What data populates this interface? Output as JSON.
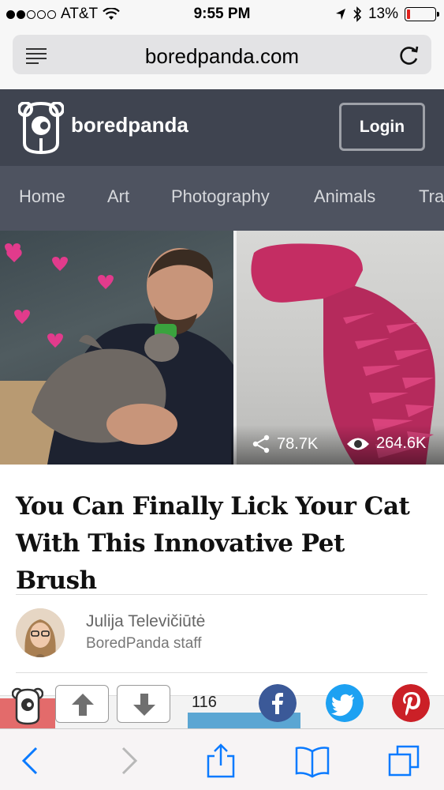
{
  "status_bar": {
    "carrier": "AT&T",
    "time": "9:55 PM",
    "battery": "13%",
    "battery_level": 0.13,
    "signal_bars": 2
  },
  "browser": {
    "url": "boredpanda.com"
  },
  "site": {
    "logo_text": "boredpanda",
    "login_label": "Login",
    "nav": [
      "Home",
      "Art",
      "Photography",
      "Animals",
      "Tra"
    ]
  },
  "hero": {
    "shares": "78.7K",
    "views": "264.6K"
  },
  "article": {
    "title_line1": "You Can Finally Lick Your Cat",
    "title_line2": "With This Innovative Pet Brush",
    "author_name": "Julija Televičiūtė",
    "author_role": "BoredPanda staff"
  },
  "actions": {
    "vote_count": "116"
  },
  "colors": {
    "header_bg": "#3f4450",
    "nav_bg": "#4e5360",
    "facebook": "#3b5998",
    "twitter": "#1da1f2",
    "pinterest": "#cb2027",
    "ios_blue": "#0a7aff"
  }
}
